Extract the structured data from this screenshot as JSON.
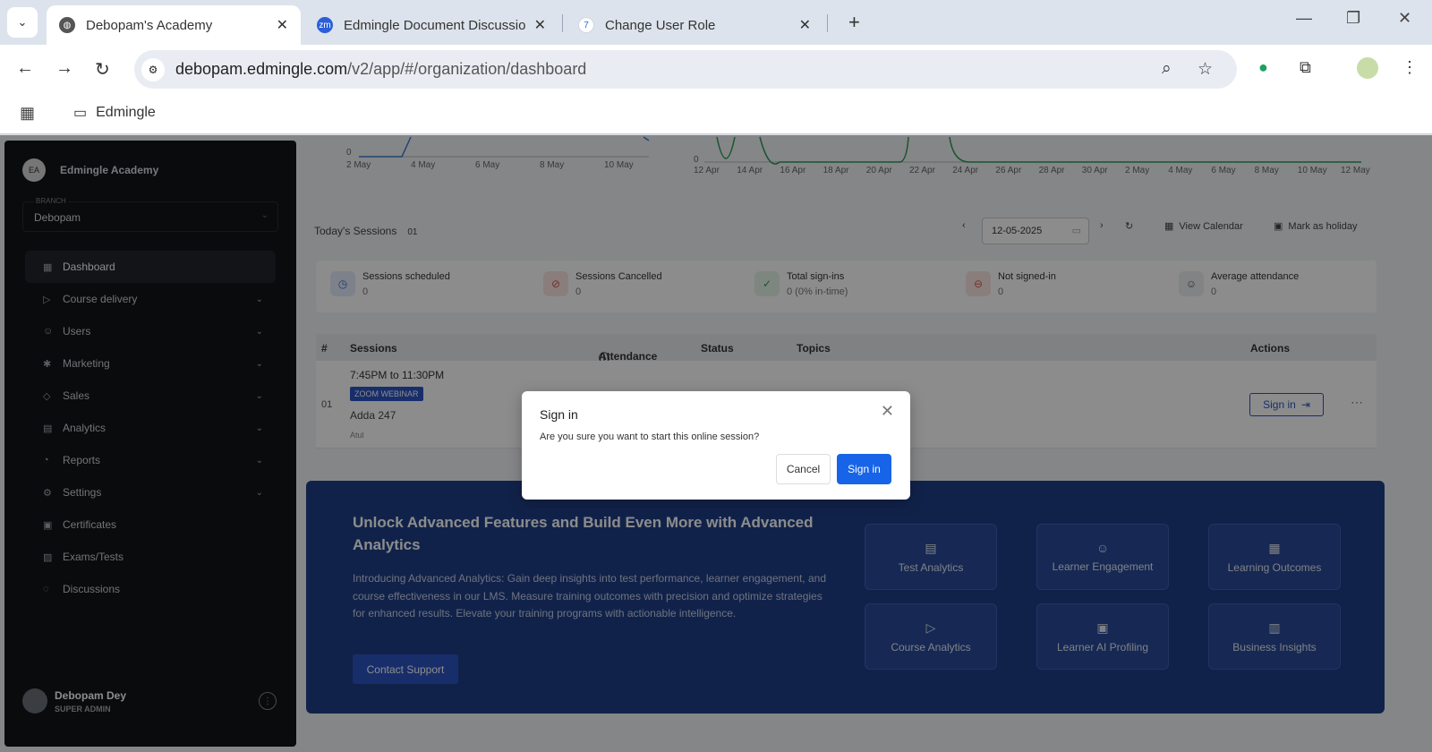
{
  "browser": {
    "tabs": [
      {
        "title": "Debopam's Academy",
        "icon": "globe-icon",
        "favicon_color": "#555555"
      },
      {
        "title": "Edmingle Document Discussion",
        "icon": "zm-icon",
        "favicon_color": "#2b5fd9",
        "favicon_text": "zm"
      },
      {
        "title": "Change User Role",
        "icon": "edmingle-icon",
        "favicon_color": "#1f6fd6"
      }
    ],
    "url_host": "debopam.edmingle.com",
    "url_path": "/v2/app/#/organization/dashboard",
    "bookmark_folder": "Edmingle"
  },
  "sidebar": {
    "org_initials": "EA",
    "org_name": "Edmingle Academy",
    "branch_label": "BRANCH",
    "branch_value": "Debopam",
    "items": [
      {
        "label": "Dashboard",
        "icon": "grid-icon",
        "active": true,
        "expandable": false
      },
      {
        "label": "Course delivery",
        "icon": "play-circle-icon",
        "expandable": true
      },
      {
        "label": "Users",
        "icon": "users-icon",
        "expandable": true
      },
      {
        "label": "Marketing",
        "icon": "megaphone-icon",
        "expandable": true
      },
      {
        "label": "Sales",
        "icon": "tag-icon",
        "expandable": true
      },
      {
        "label": "Analytics",
        "icon": "analytics-icon",
        "expandable": true
      },
      {
        "label": "Reports",
        "icon": "pie-icon",
        "expandable": true
      },
      {
        "label": "Settings",
        "icon": "gear-icon",
        "expandable": true
      },
      {
        "label": "Certificates",
        "icon": "certificate-icon",
        "expandable": false
      },
      {
        "label": "Exams/Tests",
        "icon": "exam-icon",
        "expandable": false
      },
      {
        "label": "Discussions",
        "icon": "chat-icon",
        "expandable": false
      }
    ],
    "user": {
      "name": "Debopam Dey",
      "role": "SUPER ADMIN"
    }
  },
  "charts": {
    "left_zero": "0",
    "left_ticks": [
      "2 May",
      "4 May",
      "6 May",
      "8 May",
      "10 May"
    ],
    "right_zero": "0",
    "right_ticks": [
      "12 Apr",
      "14 Apr",
      "16 Apr",
      "18 Apr",
      "20 Apr",
      "22 Apr",
      "24 Apr",
      "26 Apr",
      "28 Apr",
      "30 Apr",
      "2 May",
      "4 May",
      "6 May",
      "8 May",
      "10 May",
      "12 May"
    ]
  },
  "sessions": {
    "title": "Today's Sessions",
    "count": "01",
    "date": "12-05-2025",
    "view_calendar": "View Calendar",
    "mark_holiday": "Mark as holiday",
    "stats": [
      {
        "label": "Sessions scheduled",
        "value": "0",
        "icon": "clock-icon",
        "bg": "#e3ebfb",
        "fg": "#2f6fe0"
      },
      {
        "label": "Sessions Cancelled",
        "value": "0",
        "icon": "cancel-icon",
        "bg": "#fbe6e4",
        "fg": "#d05a4b"
      },
      {
        "label": "Total sign-ins",
        "value": "0 (0% in-time)",
        "icon": "check-icon",
        "bg": "#e3f6ea",
        "fg": "#2a9b58"
      },
      {
        "label": "Not signed-in",
        "value": "0",
        "icon": "minus-circle-icon",
        "bg": "#fbe6e4",
        "fg": "#d05a4b"
      },
      {
        "label": "Average attendance",
        "value": "0",
        "icon": "people-icon",
        "bg": "#eceef1",
        "fg": "#555555"
      }
    ],
    "columns": {
      "num": "#",
      "sessions": "Sessions",
      "attendance": "Attendance",
      "status": "Status",
      "topics": "Topics",
      "actions": "Actions"
    },
    "row": {
      "num": "01",
      "time": "7:45PM to 11:30PM",
      "badge": "ZOOM WEBINAR",
      "name": "Adda 247",
      "tutor": "Atul",
      "action": "Sign in"
    }
  },
  "banner": {
    "title": "Unlock Advanced Features and Build Even More with Advanced Analytics",
    "body": "Introducing Advanced Analytics: Gain deep insights into test performance, learner engagement, and course effectiveness in our LMS. Measure training outcomes with precision and optimize strategies for enhanced results. Elevate your training programs with actionable intelligence.",
    "cta": "Contact Support",
    "features": [
      {
        "label": "Test Analytics",
        "icon": "test-analytics-icon"
      },
      {
        "label": "Learner Engagement",
        "icon": "engagement-icon"
      },
      {
        "label": "Learning Outcomes",
        "icon": "outcomes-icon"
      },
      {
        "label": "Course Analytics",
        "icon": "course-analytics-icon"
      },
      {
        "label": "Learner AI Profiling",
        "icon": "ai-profile-icon"
      },
      {
        "label": "Business Insights",
        "icon": "insights-icon"
      }
    ]
  },
  "modal": {
    "title": "Sign in",
    "body": "Are you sure you want to start this online session?",
    "cancel": "Cancel",
    "confirm": "Sign in"
  }
}
